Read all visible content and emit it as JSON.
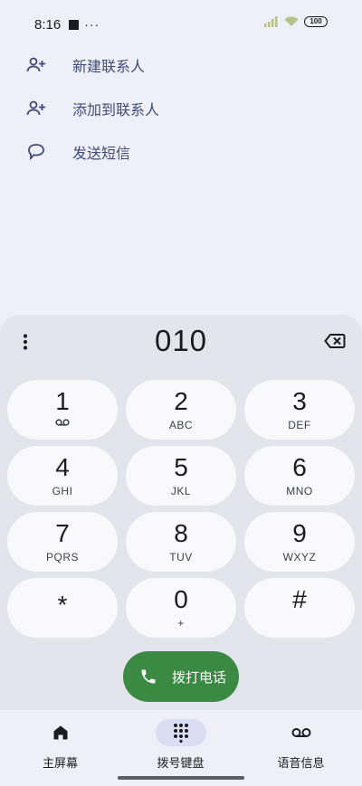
{
  "status_bar": {
    "time": "8:16",
    "overflow": "···",
    "battery": "100"
  },
  "suggestions": [
    {
      "icon": "person-add-icon",
      "label": "新建联系人"
    },
    {
      "icon": "person-add-icon",
      "label": "添加到联系人"
    },
    {
      "icon": "message-icon",
      "label": "发送短信"
    }
  ],
  "dialer": {
    "number": "010"
  },
  "keys": [
    {
      "digit": "1",
      "letters": ""
    },
    {
      "digit": "2",
      "letters": "ABC"
    },
    {
      "digit": "3",
      "letters": "DEF"
    },
    {
      "digit": "4",
      "letters": "GHI"
    },
    {
      "digit": "5",
      "letters": "JKL"
    },
    {
      "digit": "6",
      "letters": "MNO"
    },
    {
      "digit": "7",
      "letters": "PQRS"
    },
    {
      "digit": "8",
      "letters": "TUV"
    },
    {
      "digit": "9",
      "letters": "WXYZ"
    },
    {
      "digit": "*",
      "letters": ""
    },
    {
      "digit": "0",
      "letters": "+"
    },
    {
      "digit": "#",
      "letters": ""
    }
  ],
  "call_button": {
    "label": "拨打电话"
  },
  "nav": [
    {
      "label": "主屏幕",
      "icon": "home-icon"
    },
    {
      "label": "拨号键盘",
      "icon": "dialpad-icon",
      "active": true
    },
    {
      "label": "语音信息",
      "icon": "voicemail-icon"
    }
  ],
  "colors": {
    "accent_text": "#414a7a",
    "call_green": "#3b8a43",
    "nav_active": "#d9def5"
  }
}
